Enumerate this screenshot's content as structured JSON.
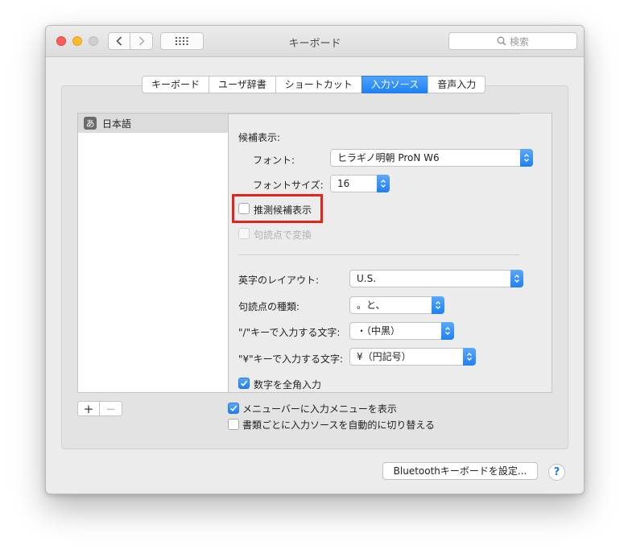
{
  "window": {
    "title": "キーボード",
    "search_placeholder": "検索"
  },
  "tabs": [
    {
      "label": "キーボード",
      "active": false
    },
    {
      "label": "ユーザ辞書",
      "active": false
    },
    {
      "label": "ショートカット",
      "active": false
    },
    {
      "label": "入力ソース",
      "active": true
    },
    {
      "label": "音声入力",
      "active": false
    }
  ],
  "input_sources": [
    {
      "icon_char": "あ",
      "label": "日本語",
      "selected": true
    }
  ],
  "candidates": {
    "section_label": "候補表示:",
    "font_label": "フォント:",
    "font_value": "ヒラギノ明朝 ProN W6",
    "font_size_label": "フォントサイズ:",
    "font_size_value": "16",
    "predictive_label": "推測候補表示",
    "predictive_checked": false,
    "punct_convert_label": "句読点で変換",
    "punct_convert_enabled": false
  },
  "options": {
    "alpha_layout_label": "英字のレイアウト:",
    "alpha_layout_value": "U.S.",
    "punct_type_label": "句読点の種類:",
    "punct_type_value": "。と、",
    "slash_key_label": "\"/\"キーで入力する文字:",
    "slash_key_value": "・（中黒）",
    "yen_key_label": "\"¥\"キーで入力する文字:",
    "yen_key_value": "¥（円記号）",
    "fullwidth_numbers_label": "数字を全角入力",
    "fullwidth_numbers_checked": true
  },
  "footer": {
    "add_label": "+",
    "remove_label": "−",
    "show_menu_label": "メニューバーに入力メニューを表示",
    "show_menu_checked": true,
    "auto_switch_label": "書類ごとに入力ソースを自動的に切り替える",
    "auto_switch_checked": false,
    "bluetooth_button_label": "Bluetoothキーボードを設定...",
    "help_label": "?"
  },
  "colors": {
    "accent": "#1e82f6",
    "highlight_box": "#e2241c"
  }
}
